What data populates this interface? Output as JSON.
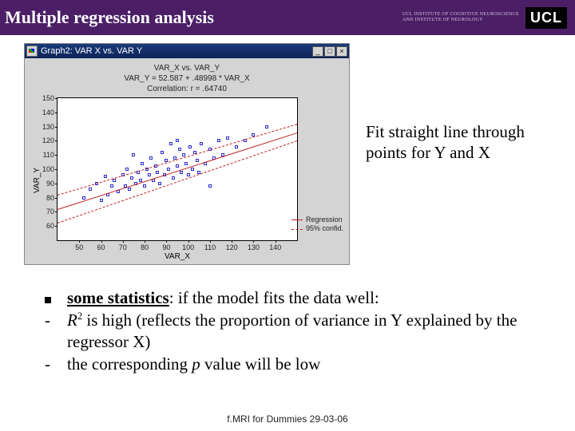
{
  "header": {
    "title": "Multiple regression analysis",
    "institute_line1": "UCL INSTITUTE OF COGNITIVE NEUROSCIENCE",
    "institute_line2": "AND INSTITUTE OF NEUROLOGY",
    "logo_text": "UCL"
  },
  "graph": {
    "window_title": "Graph2:  VAR X vs. VAR Y",
    "heading_line1": "VAR_X vs. VAR_Y",
    "heading_line2": "VAR_Y = 52.587 + .48998 * VAR_X",
    "heading_line3": "Correlation: r = .64740",
    "xlabel": "VAR_X",
    "ylabel": "VAR_Y",
    "legend": {
      "reg": "Regression",
      "conf": "95% confid."
    },
    "winbtns": {
      "min": "_",
      "max": "□",
      "close": "×"
    }
  },
  "chart_data": {
    "type": "scatter",
    "title": "VAR_X vs. VAR_Y",
    "xlabel": "VAR_X",
    "ylabel": "VAR_Y",
    "xlim": [
      40,
      150
    ],
    "ylim": [
      50,
      150
    ],
    "xticks": [
      50,
      60,
      70,
      80,
      90,
      100,
      110,
      120,
      130,
      140
    ],
    "yticks": [
      60,
      70,
      80,
      90,
      100,
      110,
      120,
      130,
      140,
      150
    ],
    "regression": {
      "slope": 0.48998,
      "intercept": 52.587,
      "r": 0.6474
    },
    "confidence": 0.95,
    "series": [
      {
        "name": "observations",
        "points": [
          [
            52,
            80
          ],
          [
            55,
            86
          ],
          [
            58,
            90
          ],
          [
            60,
            78
          ],
          [
            62,
            95
          ],
          [
            63,
            82
          ],
          [
            65,
            88
          ],
          [
            66,
            92
          ],
          [
            68,
            84
          ],
          [
            70,
            96
          ],
          [
            71,
            88
          ],
          [
            72,
            100
          ],
          [
            73,
            86
          ],
          [
            74,
            94
          ],
          [
            75,
            110
          ],
          [
            76,
            90
          ],
          [
            77,
            98
          ],
          [
            78,
            92
          ],
          [
            79,
            104
          ],
          [
            80,
            88
          ],
          [
            81,
            100
          ],
          [
            82,
            96
          ],
          [
            83,
            108
          ],
          [
            84,
            92
          ],
          [
            85,
            102
          ],
          [
            86,
            98
          ],
          [
            87,
            90
          ],
          [
            88,
            112
          ],
          [
            89,
            96
          ],
          [
            90,
            106
          ],
          [
            91,
            100
          ],
          [
            92,
            118
          ],
          [
            93,
            94
          ],
          [
            94,
            108
          ],
          [
            95,
            102
          ],
          [
            96,
            114
          ],
          [
            97,
            98
          ],
          [
            98,
            110
          ],
          [
            99,
            104
          ],
          [
            100,
            96
          ],
          [
            101,
            116
          ],
          [
            102,
            100
          ],
          [
            103,
            112
          ],
          [
            104,
            106
          ],
          [
            105,
            98
          ],
          [
            106,
            118
          ],
          [
            108,
            104
          ],
          [
            110,
            114
          ],
          [
            112,
            108
          ],
          [
            114,
            120
          ],
          [
            116,
            110
          ],
          [
            118,
            122
          ],
          [
            122,
            116
          ],
          [
            126,
            120
          ],
          [
            130,
            124
          ],
          [
            136,
            130
          ],
          [
            110,
            88
          ],
          [
            95,
            120
          ]
        ]
      }
    ]
  },
  "caption": "Fit straight line through points for Y and X",
  "bullets": {
    "main": {
      "pre": "some statistics",
      "post": ": if the model fits the data well:"
    },
    "sub1": {
      "r2_pre": "R",
      "r2_sup": "2",
      "rest": "  is high (reflects the proportion of variance in Y explained by the regressor X)"
    },
    "sub2": {
      "pre": "the corresponding ",
      "p": "p",
      "post": " value will be low"
    }
  },
  "footer": "f.MRI for Dummies 29-03-06"
}
